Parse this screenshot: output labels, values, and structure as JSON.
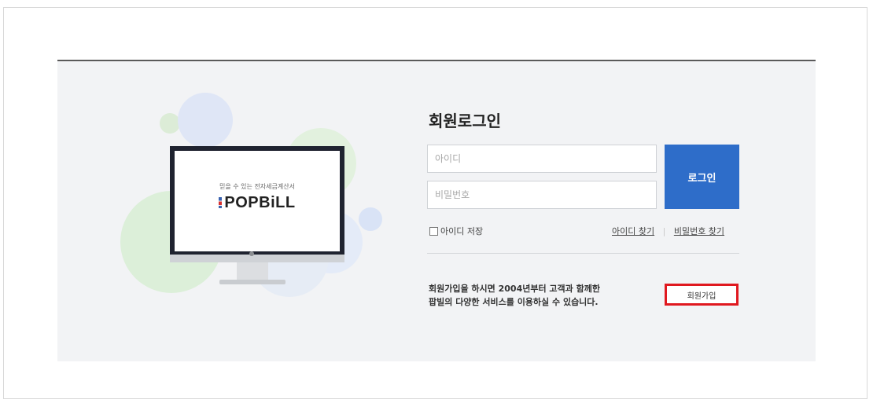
{
  "promo": {
    "tagline": "믿을 수 있는 전자세금계산서",
    "logo_text": "POPBiLL"
  },
  "login": {
    "title": "회원로그인",
    "id_placeholder": "아이디",
    "password_placeholder": "비밀번호",
    "login_button": "로그인",
    "save_id_label": "아이디 저장",
    "find_id_link": "아이디 찾기",
    "find_password_link": "비밀번호 찾기"
  },
  "signup": {
    "description_line1": "회원가입을 하시면 2004년부터 고객과 함께한",
    "description_line2": "팝빌의 다양한 서비스를 이용하실 수 있습니다.",
    "signup_button": "회원가입"
  },
  "colors": {
    "accent": "#2e6dc9",
    "highlight": "#e0181f",
    "panel_background": "#f2f3f5"
  }
}
